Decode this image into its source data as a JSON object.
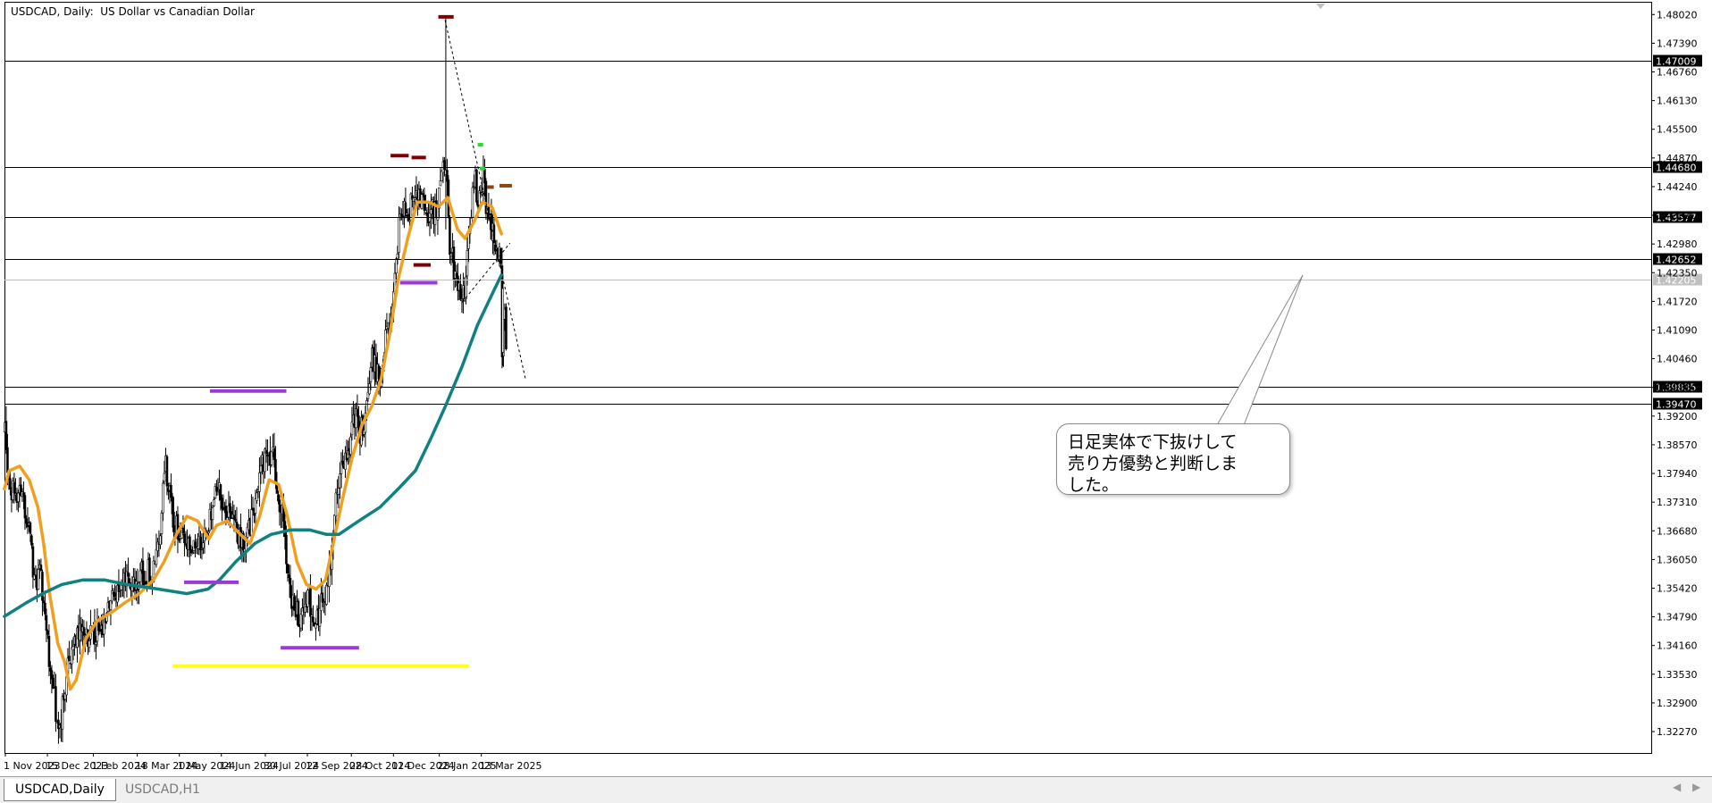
{
  "window": {
    "title": "USDCAD, Daily:  US Dollar vs Canadian Dollar"
  },
  "tabs": [
    {
      "label": "USDCAD,Daily",
      "active": true
    },
    {
      "label": "USDCAD,H1",
      "active": false
    }
  ],
  "nav": {
    "left_icon": "triangle-left-icon",
    "right_icon": "triangle-right-icon"
  },
  "annotation": {
    "text": "日足実体で下抜けして\n売り方優勢と判断しま\nした。"
  },
  "chart_data": {
    "type": "candlestick",
    "symbol": "USDCAD",
    "timeframe": "Daily",
    "ylim": [
      1.318,
      1.483
    ],
    "grid": false,
    "y_ticks": [
      "1.48020",
      "1.47390",
      "1.46760",
      "1.46130",
      "1.45500",
      "1.44870",
      "1.44240",
      "1.43610",
      "1.42980",
      "1.42350",
      "1.41720",
      "1.41090",
      "1.40460",
      "1.39830",
      "1.39200",
      "1.38570",
      "1.37940",
      "1.37310",
      "1.36680",
      "1.36050",
      "1.35420",
      "1.34790",
      "1.34160",
      "1.33530",
      "1.32900",
      "1.32270"
    ],
    "x_ticks": [
      {
        "label": "1 Nov 2023",
        "date": "2023-11-01"
      },
      {
        "label": "15 Dec 2023",
        "date": "2023-12-15"
      },
      {
        "label": "1 Feb 2024",
        "date": "2024-02-01"
      },
      {
        "label": "18 Mar 2024",
        "date": "2024-03-18"
      },
      {
        "label": "1 May 2024",
        "date": "2024-05-01"
      },
      {
        "label": "14 Jun 2024",
        "date": "2024-06-14"
      },
      {
        "label": "30 Jul 2024",
        "date": "2024-07-30"
      },
      {
        "label": "12 Sep 2024",
        "date": "2024-09-12"
      },
      {
        "label": "28 Oct 2024",
        "date": "2024-10-28"
      },
      {
        "label": "11 Dec 2024",
        "date": "2024-12-11"
      },
      {
        "label": "28 Jan 2025",
        "date": "2025-01-28"
      },
      {
        "label": "13 Mar 2025",
        "date": "2025-03-13"
      }
    ],
    "price_path": [
      [
        "2023-10-31",
        1.389
      ],
      [
        "2023-11-06",
        1.375
      ],
      [
        "2023-11-14",
        1.376
      ],
      [
        "2023-11-22",
        1.372
      ],
      [
        "2023-12-01",
        1.356
      ],
      [
        "2023-12-07",
        1.357
      ],
      [
        "2023-12-14",
        1.343
      ],
      [
        "2023-12-21",
        1.331
      ],
      [
        "2023-12-27",
        1.322
      ],
      [
        "2024-01-05",
        1.337
      ],
      [
        "2024-01-15",
        1.344
      ],
      [
        "2024-01-22",
        1.345
      ],
      [
        "2024-02-01",
        1.343
      ],
      [
        "2024-02-12",
        1.347
      ],
      [
        "2024-02-22",
        1.352
      ],
      [
        "2024-03-05",
        1.355
      ],
      [
        "2024-03-15",
        1.356
      ],
      [
        "2024-03-25",
        1.358
      ],
      [
        "2024-04-05",
        1.358
      ],
      [
        "2024-04-12",
        1.37
      ],
      [
        "2024-04-16",
        1.382
      ],
      [
        "2024-04-24",
        1.368
      ],
      [
        "2024-05-03",
        1.366
      ],
      [
        "2024-05-15",
        1.364
      ],
      [
        "2024-05-28",
        1.365
      ],
      [
        "2024-06-10",
        1.376
      ],
      [
        "2024-06-20",
        1.37
      ],
      [
        "2024-06-28",
        1.369
      ],
      [
        "2024-07-05",
        1.363
      ],
      [
        "2024-07-15",
        1.369
      ],
      [
        "2024-07-25",
        1.381
      ],
      [
        "2024-08-05",
        1.384
      ],
      [
        "2024-08-15",
        1.372
      ],
      [
        "2024-08-26",
        1.351
      ],
      [
        "2024-09-06",
        1.347
      ],
      [
        "2024-09-12",
        1.354
      ],
      [
        "2024-09-18",
        1.344
      ],
      [
        "2024-09-25",
        1.35
      ],
      [
        "2024-10-03",
        1.354
      ],
      [
        "2024-10-10",
        1.37
      ],
      [
        "2024-10-16",
        1.38
      ],
      [
        "2024-10-24",
        1.385
      ],
      [
        "2024-11-01",
        1.392
      ],
      [
        "2024-11-06",
        1.388
      ],
      [
        "2024-11-12",
        1.394
      ],
      [
        "2024-11-18",
        1.406
      ],
      [
        "2024-11-26",
        1.399
      ],
      [
        "2024-12-04",
        1.411
      ],
      [
        "2024-12-10",
        1.416
      ],
      [
        "2024-12-18",
        1.439
      ],
      [
        "2024-12-26",
        1.437
      ],
      [
        "2025-01-03",
        1.441
      ],
      [
        "2025-01-10",
        1.44
      ],
      [
        "2025-01-17",
        1.437
      ],
      [
        "2025-01-24",
        1.436
      ],
      [
        "2025-01-29",
        1.442
      ],
      [
        "2025-02-03",
        1.448
      ],
      [
        "2025-02-07",
        1.431
      ],
      [
        "2025-02-14",
        1.422
      ],
      [
        "2025-02-21",
        1.417
      ],
      [
        "2025-02-28",
        1.431
      ],
      [
        "2025-03-04",
        1.446
      ],
      [
        "2025-03-10",
        1.438
      ],
      [
        "2025-03-14",
        1.445
      ],
      [
        "2025-03-20",
        1.435
      ],
      [
        "2025-03-26",
        1.43
      ],
      [
        "2025-03-31",
        1.428
      ],
      [
        "2025-04-03",
        1.42
      ],
      [
        "2025-04-08",
        1.408
      ]
    ],
    "candles": [
      {
        "date": "2025-02-03",
        "open": 1.445,
        "high": 1.4793,
        "low": 1.433,
        "close": 1.446
      },
      {
        "date": "2025-04-03",
        "open": 1.425,
        "high": 1.429,
        "low": 1.4025,
        "close": 1.405
      },
      {
        "date": "2025-04-04",
        "open": 1.406,
        "high": 1.423,
        "low": 1.403,
        "close": 1.42
      }
    ],
    "series": [
      {
        "values": [
          [
            "2023-10-31",
            1.376
          ],
          [
            "2023-11-05",
            1.38
          ],
          [
            "2023-11-16",
            1.381
          ],
          [
            "2023-11-26",
            1.378
          ],
          [
            "2023-12-05",
            1.372
          ],
          [
            "2023-12-11",
            1.364
          ],
          [
            "2023-12-18",
            1.352
          ],
          [
            "2023-12-26",
            1.342
          ],
          [
            "2024-01-02",
            1.338
          ],
          [
            "2024-01-08",
            1.332
          ],
          [
            "2024-01-14",
            1.334
          ],
          [
            "2024-01-24",
            1.343
          ],
          [
            "2024-02-05",
            1.347
          ],
          [
            "2024-02-21",
            1.349
          ],
          [
            "2024-03-05",
            1.351
          ],
          [
            "2024-03-20",
            1.353
          ],
          [
            "2024-04-04",
            1.356
          ],
          [
            "2024-04-15",
            1.36
          ],
          [
            "2024-04-28",
            1.366
          ],
          [
            "2024-05-09",
            1.37
          ],
          [
            "2024-05-20",
            1.369
          ],
          [
            "2024-06-01",
            1.365
          ],
          [
            "2024-06-09",
            1.368
          ],
          [
            "2024-06-20",
            1.369
          ],
          [
            "2024-07-04",
            1.366
          ],
          [
            "2024-07-14",
            1.364
          ],
          [
            "2024-07-24",
            1.37
          ],
          [
            "2024-08-03",
            1.378
          ],
          [
            "2024-08-13",
            1.377
          ],
          [
            "2024-08-22",
            1.37
          ],
          [
            "2024-09-01",
            1.36
          ],
          [
            "2024-09-11",
            1.355
          ],
          [
            "2024-09-21",
            1.354
          ],
          [
            "2024-10-01",
            1.356
          ],
          [
            "2024-10-09",
            1.364
          ],
          [
            "2024-10-19",
            1.374
          ],
          [
            "2024-10-29",
            1.383
          ],
          [
            "2024-11-08",
            1.39
          ],
          [
            "2024-11-18",
            1.394
          ],
          [
            "2024-11-28",
            1.4
          ],
          [
            "2024-12-08",
            1.411
          ],
          [
            "2024-12-16",
            1.422
          ],
          [
            "2024-12-26",
            1.431
          ],
          [
            "2025-01-05",
            1.439
          ],
          [
            "2025-01-17",
            1.439
          ],
          [
            "2025-01-27",
            1.438
          ],
          [
            "2025-02-06",
            1.44
          ],
          [
            "2025-02-16",
            1.433
          ],
          [
            "2025-02-24",
            1.431
          ],
          [
            "2025-03-06",
            1.435
          ],
          [
            "2025-03-14",
            1.439
          ],
          [
            "2025-03-24",
            1.438
          ],
          [
            "2025-04-03",
            1.432
          ]
        ],
        "color": "#f0a020"
      },
      {
        "values": [
          [
            "2023-10-31",
            1.348
          ],
          [
            "2023-11-23",
            1.351
          ],
          [
            "2023-12-10",
            1.353
          ],
          [
            "2023-12-30",
            1.355
          ],
          [
            "2024-01-21",
            1.356
          ],
          [
            "2024-02-13",
            1.356
          ],
          [
            "2024-03-07",
            1.355
          ],
          [
            "2024-04-09",
            1.354
          ],
          [
            "2024-05-09",
            1.353
          ],
          [
            "2024-05-31",
            1.354
          ],
          [
            "2024-06-12",
            1.356
          ],
          [
            "2024-06-29",
            1.36
          ],
          [
            "2024-07-19",
            1.364
          ],
          [
            "2024-08-05",
            1.366
          ],
          [
            "2024-08-26",
            1.367
          ],
          [
            "2024-09-14",
            1.367
          ],
          [
            "2024-10-02",
            1.366
          ],
          [
            "2024-10-15",
            1.366
          ],
          [
            "2024-11-05",
            1.369
          ],
          [
            "2024-11-27",
            1.372
          ],
          [
            "2024-12-16",
            1.376
          ],
          [
            "2025-01-03",
            1.38
          ],
          [
            "2025-01-19",
            1.387
          ],
          [
            "2025-02-03",
            1.394
          ],
          [
            "2025-02-21",
            1.403
          ],
          [
            "2025-03-09",
            1.412
          ],
          [
            "2025-03-27",
            1.42
          ],
          [
            "2025-04-03",
            1.423
          ]
        ],
        "color": "#108080"
      }
    ],
    "horizontal_lines": [
      {
        "price": 1.47009,
        "label": "1.47009"
      },
      {
        "price": 1.4468,
        "label": "1.44680"
      },
      {
        "price": 1.43577,
        "label": "1.43577"
      },
      {
        "price": 1.42652,
        "label": "1.42652"
      },
      {
        "price": 1.42205,
        "label": "1.42205",
        "color": "#c0c0c0"
      },
      {
        "price": 1.39835,
        "label": "1.39835"
      },
      {
        "price": 1.3947,
        "label": "1.39470"
      }
    ],
    "segments": [
      {
        "start": [
          "2024-06-02",
          1.3975
        ],
        "end": [
          "2024-08-21",
          1.3975
        ],
        "color": "#9c3ad8"
      },
      {
        "start": [
          "2024-05-06",
          1.3555
        ],
        "end": [
          "2024-07-02",
          1.3555
        ],
        "color": "#9c3ad8"
      },
      {
        "start": [
          "2024-08-15",
          1.3411
        ],
        "end": [
          "2024-11-05",
          1.3411
        ],
        "color": "#9c3ad8"
      },
      {
        "start": [
          "2024-12-18",
          1.4213
        ],
        "end": [
          "2025-01-26",
          1.4213
        ],
        "color": "#9c3ad8"
      },
      {
        "start": [
          "2024-04-24",
          1.3371
        ],
        "end": [
          "2025-02-28",
          1.3371
        ],
        "color": "#ffff20"
      },
      {
        "start": [
          "2024-12-08",
          1.4492
        ],
        "end": [
          "2024-12-27",
          1.4492
        ],
        "color": "#800000"
      },
      {
        "start": [
          "2024-12-30",
          1.4488
        ],
        "end": [
          "2025-01-14",
          1.4488
        ],
        "color": "#800000"
      },
      {
        "start": [
          "2025-01-01",
          1.4252
        ],
        "end": [
          "2025-01-19",
          1.4252
        ],
        "color": "#800000"
      },
      {
        "start": [
          "2025-01-27",
          1.4797
        ],
        "end": [
          "2025-02-12",
          1.4797
        ],
        "color": "#800000"
      },
      {
        "start": [
          "2025-03-19",
          1.4423
        ],
        "end": [
          "2025-03-26",
          1.4423
        ],
        "color": "#8b4513"
      },
      {
        "start": [
          "2025-04-01",
          1.4426
        ],
        "end": [
          "2025-04-14",
          1.4426
        ],
        "color": "#8b4513"
      }
    ],
    "trendlines": [
      {
        "start": [
          "2025-02-03",
          1.479
        ],
        "end": [
          "2025-04-28",
          1.4003
        ],
        "color": "#000000",
        "dashed": true
      },
      {
        "start": [
          "2025-02-21",
          1.417
        ],
        "end": [
          "2025-04-12",
          1.43
        ],
        "color": "#000000",
        "dashed": true
      }
    ],
    "markers": [
      {
        "date": "2025-03-12",
        "price": 1.4516,
        "color": "#20e020"
      },
      {
        "date": "2025-03-14",
        "price": 1.4464,
        "color": "#20e020"
      }
    ]
  }
}
